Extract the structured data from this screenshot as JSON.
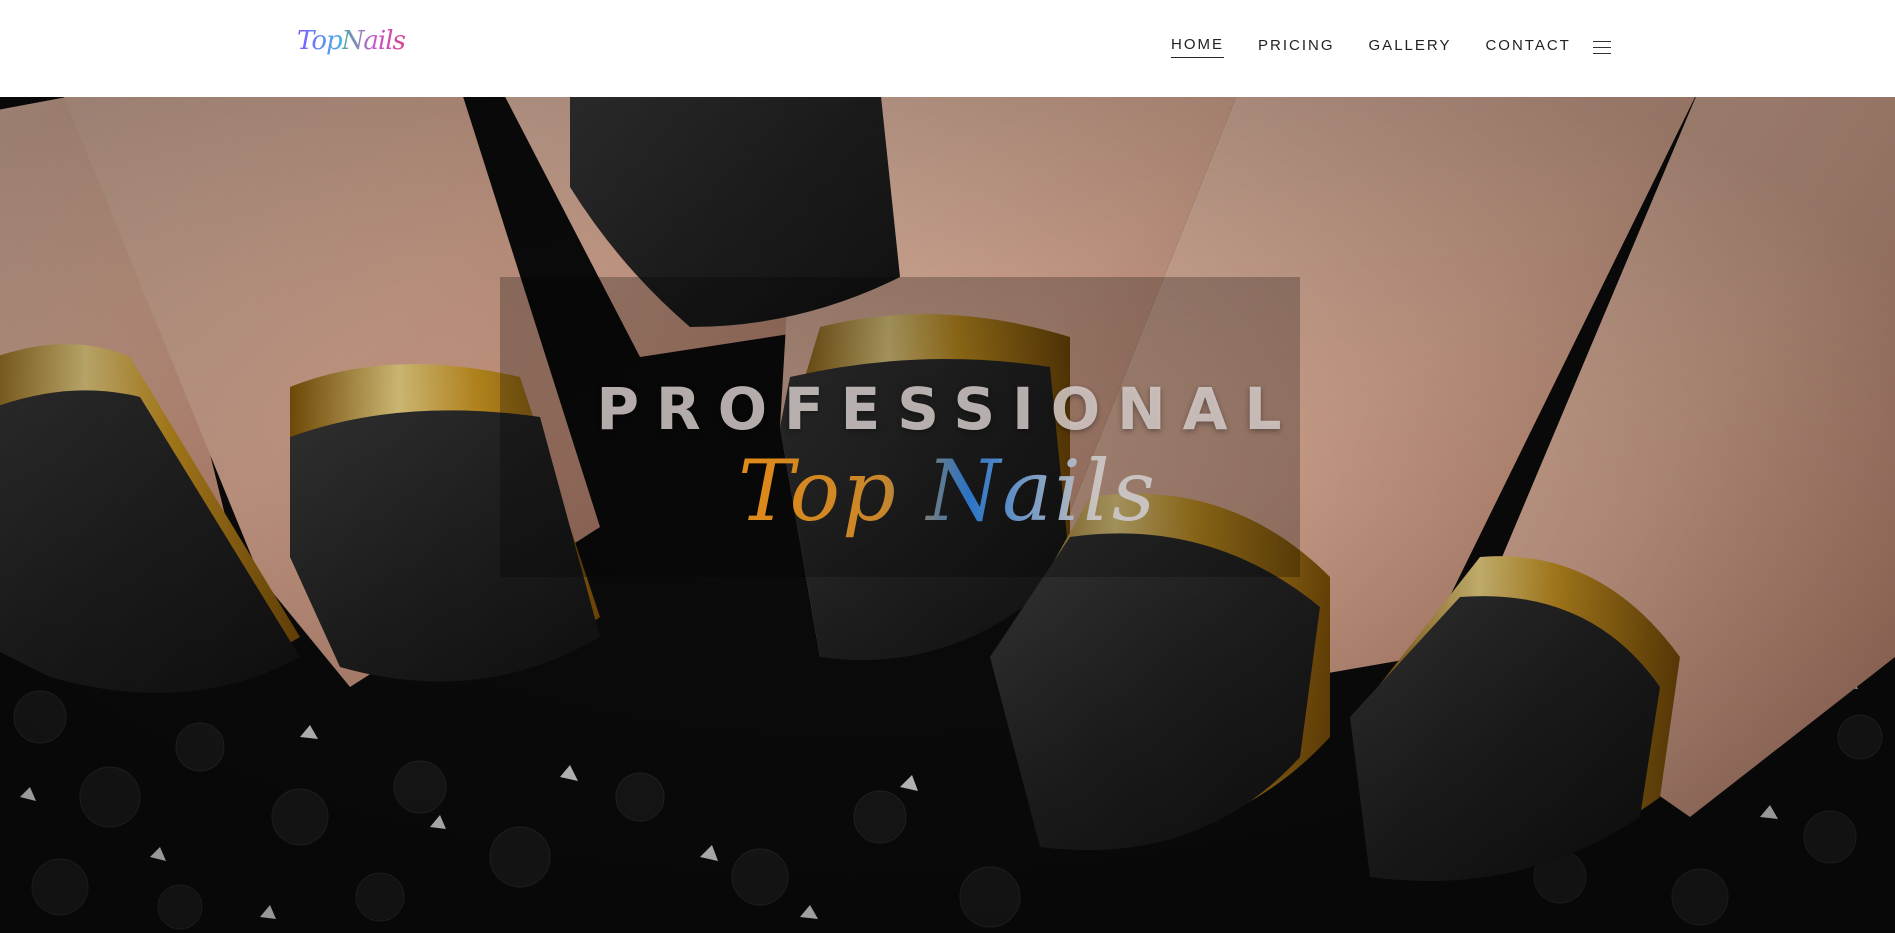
{
  "brand": {
    "logo_part1": "Top",
    "logo_part2": "Nails"
  },
  "nav": {
    "items": [
      {
        "label": "HOME",
        "active": true
      },
      {
        "label": "PRICING",
        "active": false
      },
      {
        "label": "GALLERY",
        "active": false
      },
      {
        "label": "CONTACT",
        "active": false
      }
    ],
    "menu_icon": "hamburger-icon"
  },
  "hero": {
    "title": "PROFESSIONAL",
    "subtitle": "Top Nails",
    "background": "photo-black-matte-nails-gold-tips"
  },
  "colors": {
    "nail_black": "#1c1c1c",
    "gold": "#c8921a",
    "skin": "#e9b9a0",
    "header_bg": "#ffffff"
  }
}
